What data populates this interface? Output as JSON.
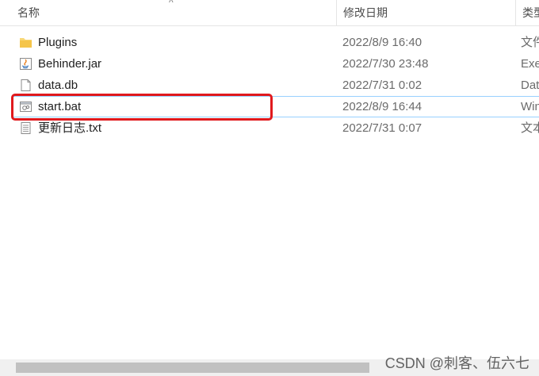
{
  "columns": {
    "name": "名称",
    "date": "修改日期",
    "type": "类型"
  },
  "sort_indicator": "^",
  "files": [
    {
      "name": "Plugins",
      "date": "2022/8/9 16:40",
      "type": "文件",
      "icon": "folder-icon"
    },
    {
      "name": "Behinder.jar",
      "date": "2022/7/30 23:48",
      "type": "Exe",
      "icon": "java-jar-icon"
    },
    {
      "name": "data.db",
      "date": "2022/7/31 0:02",
      "type": "Dat",
      "icon": "file-icon"
    },
    {
      "name": "start.bat",
      "date": "2022/8/9 16:44",
      "type": "Win",
      "icon": "batch-file-icon"
    },
    {
      "name": "更新日志.txt",
      "date": "2022/7/31 0:07",
      "type": "文本",
      "icon": "text-file-icon"
    }
  ],
  "highlight_color": "#e0191d",
  "watermark": "CSDN @刺客、伍六七"
}
